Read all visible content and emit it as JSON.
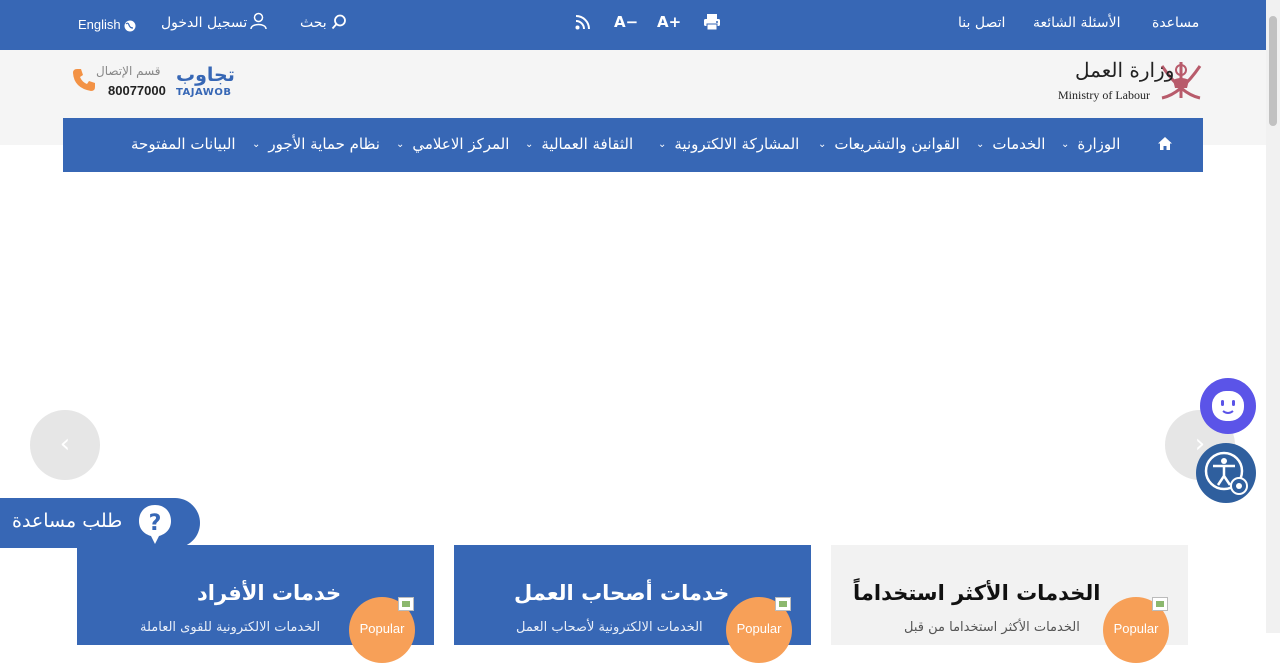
{
  "topbar": {
    "help": "مساعدة",
    "faq": "الأسئلة الشائعة",
    "contact": "اتصل بنا",
    "search": "بحث",
    "login": "تسجيل الدخول",
    "language": "English",
    "font_increase": "A+",
    "font_decrease": "A−"
  },
  "header": {
    "ministry_ar": "وزارة العمل",
    "ministry_en": "Ministry of Labour",
    "tajawob_brand": "تجاوب",
    "tajawob_sub": "TAJAWOB",
    "contact_label": "قسم الإتصال",
    "contact_number": "80077000"
  },
  "nav": {
    "items": [
      {
        "label": "الوزارة",
        "dropdown": true
      },
      {
        "label": "الخدمات",
        "dropdown": true
      },
      {
        "label": "القوانين والتشريعات",
        "dropdown": true
      },
      {
        "label": "المشاركة الالكترونية",
        "dropdown": true
      },
      {
        "label": "الثقافة العمالية",
        "dropdown": true
      },
      {
        "label": "المركز الاعلامي",
        "dropdown": true
      },
      {
        "label": "نظام حماية الأجور",
        "dropdown": true
      },
      {
        "label": "البيانات المفتوحة",
        "dropdown": false
      }
    ]
  },
  "help_request": "طلب مساعدة",
  "cards": [
    {
      "title": "الخدمات الأكثر استخداماً",
      "desc": "الخدمات الأكثر استخداما من قبل",
      "badge": "Popular"
    },
    {
      "title": "خدمات أصحاب العمل",
      "desc": "الخدمات الالكترونية لأصحاب العمل",
      "badge": "Popular"
    },
    {
      "title": "خدمات الأفراد",
      "desc": "الخدمات الالكترونية للقوى العاملة",
      "badge": "Popular"
    }
  ],
  "colors": {
    "primary": "#3767b5",
    "accent": "#f7a058",
    "bot": "#5b54e8"
  }
}
